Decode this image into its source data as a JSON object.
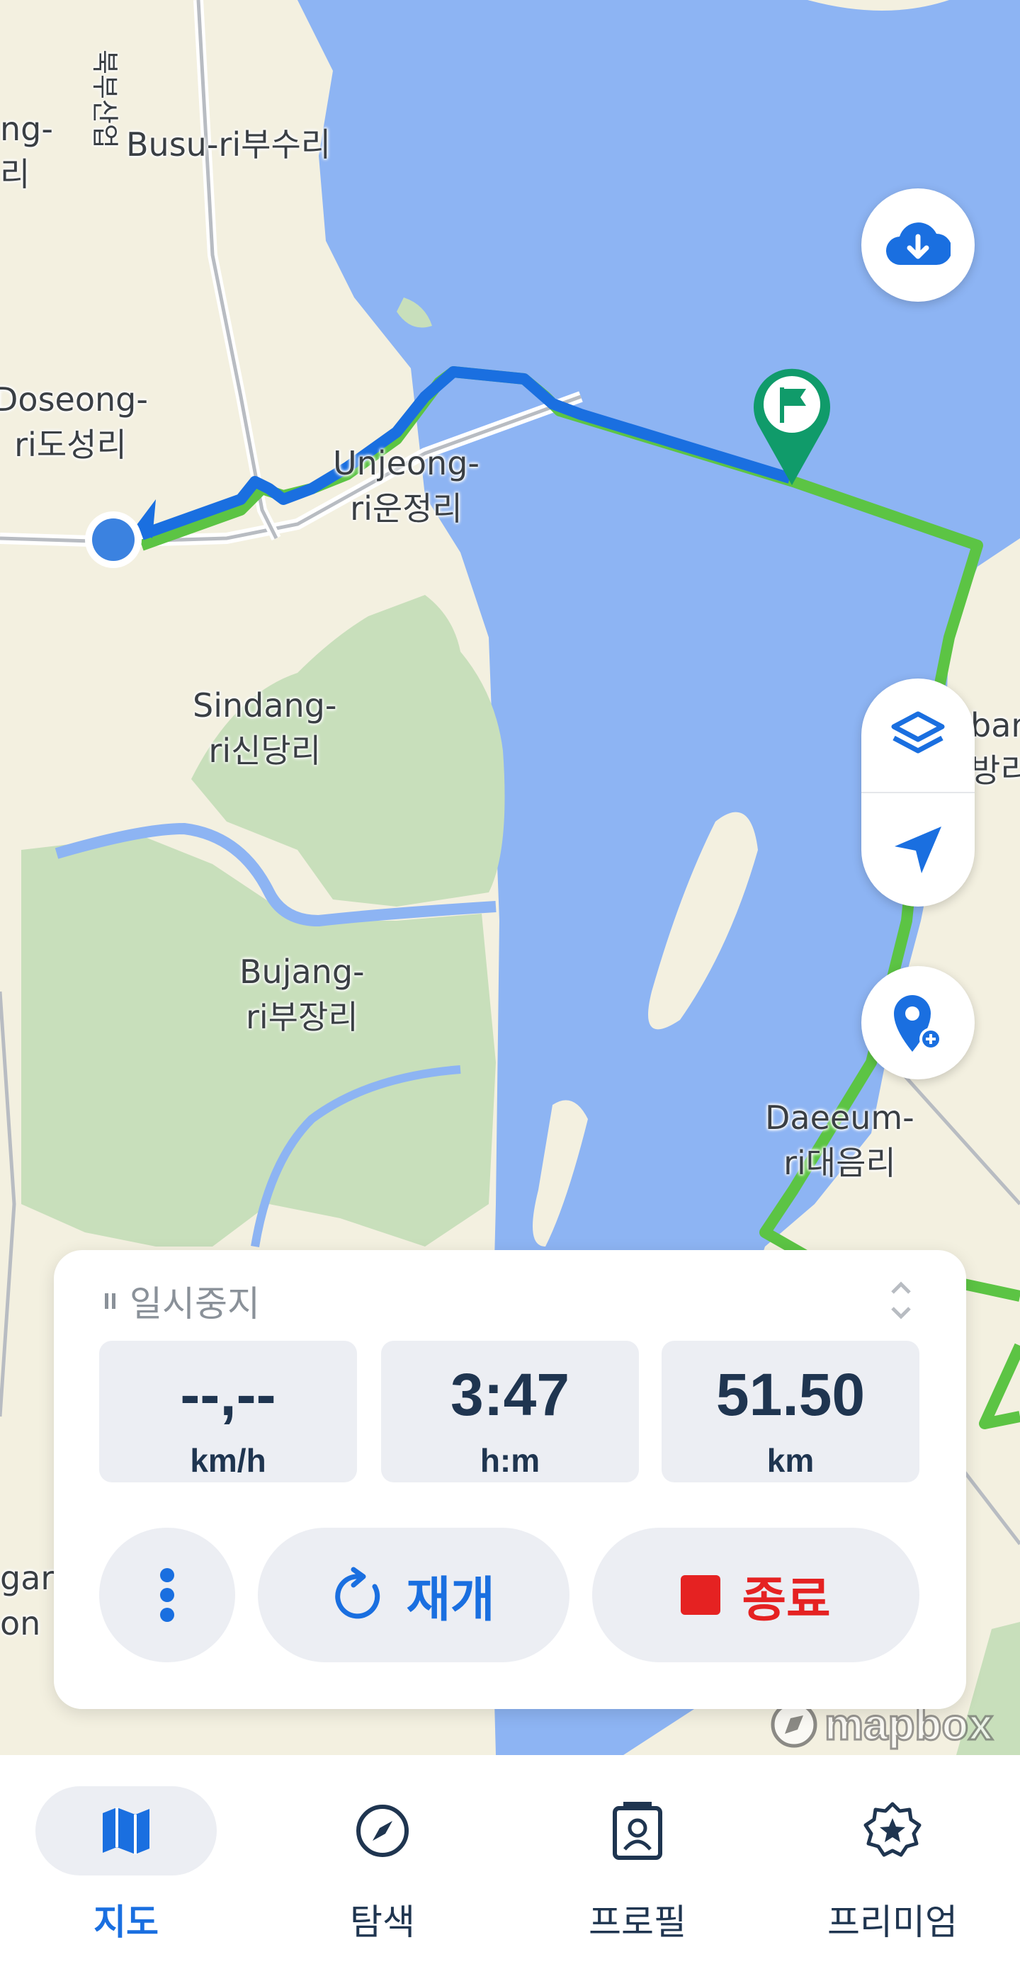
{
  "map": {
    "labels": [
      {
        "id": "busu",
        "text": "Busu-ri부수리"
      },
      {
        "id": "road",
        "text": "북부산업"
      },
      {
        "id": "ng",
        "text": "ng-\n리"
      },
      {
        "id": "doseong",
        "text": "Doseong-\nri도성리"
      },
      {
        "id": "unjeong",
        "text": "Unjeong-\nri운정리"
      },
      {
        "id": "sindang",
        "text": "Sindang-\nri신당리"
      },
      {
        "id": "bujang",
        "text": "Bujang-\nri부장리"
      },
      {
        "id": "daeeum",
        "text": "Daeeum-\nri대음리"
      },
      {
        "id": "ban",
        "text": "ban\n방리"
      },
      {
        "id": "gar",
        "text": "gar\non"
      }
    ],
    "attribution": "mapbox",
    "colors": {
      "water": "#8db4f3",
      "land": "#f3f0e0",
      "park": "#c8dfbb",
      "route_done": "#1a6fe0",
      "route_plan": "#5cc444",
      "poi": "#109b6a",
      "accent": "#1a73e8",
      "stop": "#e52222"
    }
  },
  "card": {
    "status": "일시중지",
    "stats": [
      {
        "value": "--,--",
        "unit": "km/h"
      },
      {
        "value": "3:47",
        "unit": "h:m"
      },
      {
        "value": "51.50",
        "unit": "km"
      }
    ],
    "resume_label": "재개",
    "stop_label": "종료"
  },
  "nav": {
    "items": [
      {
        "label": "지도",
        "icon": "map-icon",
        "active": true
      },
      {
        "label": "탐색",
        "icon": "compass-icon",
        "active": false
      },
      {
        "label": "프로필",
        "icon": "profile-icon",
        "active": false
      },
      {
        "label": "프리미엄",
        "icon": "premium-icon",
        "active": false
      }
    ]
  }
}
